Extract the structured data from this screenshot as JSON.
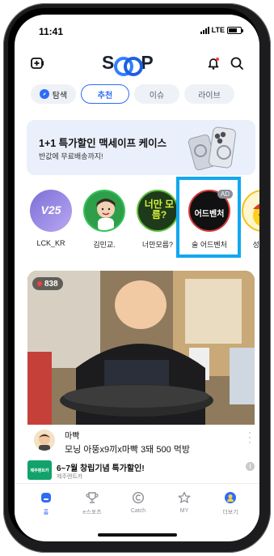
{
  "status_bar": {
    "time": "11:41",
    "network": "LTE"
  },
  "header": {
    "logo_text": "SOOP"
  },
  "tabs": [
    {
      "label": "탐색"
    },
    {
      "label": "추천"
    },
    {
      "label": "이슈"
    },
    {
      "label": "라이브"
    }
  ],
  "banner": {
    "title": "1+1 특가할인 맥세이프 케이스",
    "subtitle": "반값에 무료배송까지!"
  },
  "streamers": [
    {
      "name": "LCK_KR",
      "avatar_text": "V25"
    },
    {
      "name": "김민교."
    },
    {
      "name": "너만모름?",
      "avatar_text": "너만 모름?"
    },
    {
      "name": "술 어드벤처",
      "avatar_text": "어드벤처",
      "badge": "AD"
    },
    {
      "name": "성진이"
    }
  ],
  "live": {
    "viewers": "838",
    "streamer": "마빡",
    "title": "모닝 아뚱x9끼x마빡 3돼 500 먹방"
  },
  "ad": {
    "title": "6~7월 창립기념 특가할인!",
    "advertiser": "제주렌트카",
    "logo_text": "제주렌트카"
  },
  "bottom_nav": [
    {
      "label": "홈"
    },
    {
      "label": "e스포츠"
    },
    {
      "label": "Catch"
    },
    {
      "label": "MY"
    },
    {
      "label": "더보기"
    }
  ],
  "colors": {
    "accent": "#2f6cf6",
    "highlight": "#11a8ef",
    "banner_bg": "#e9f0fb"
  }
}
